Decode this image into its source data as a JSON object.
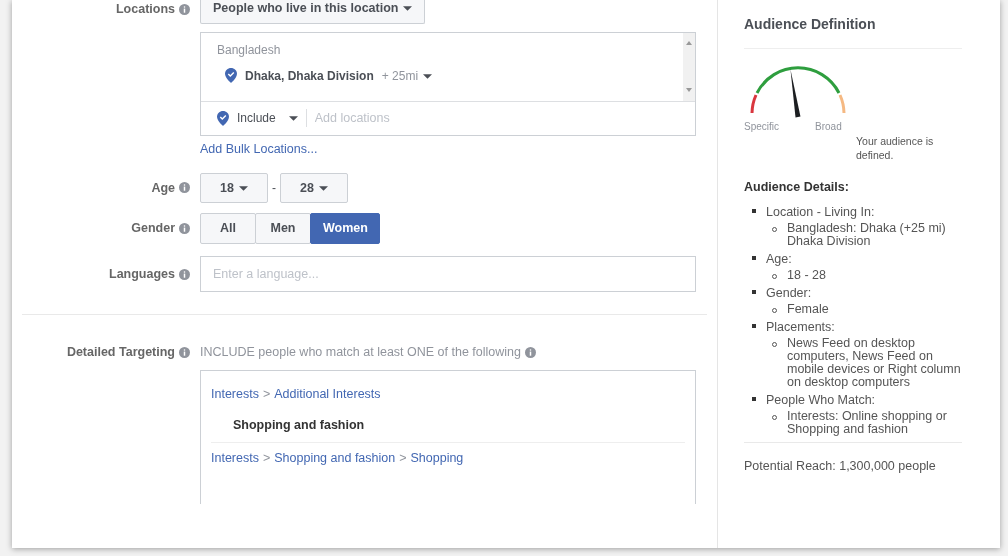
{
  "targeting": {
    "locations": {
      "label": "Locations",
      "type_dropdown": "People who live in this location",
      "groups": [
        {
          "country": "Bangladesh",
          "places": [
            {
              "name": "Dhaka, Dhaka Division",
              "radius": "+ 25mi"
            }
          ]
        }
      ],
      "include_dropdown": "Include",
      "placeholder": "Add locations",
      "bulk_link": "Add Bulk Locations..."
    },
    "age": {
      "label": "Age",
      "min": "18",
      "separator": "-",
      "max": "28"
    },
    "gender": {
      "label": "Gender",
      "options": [
        {
          "label": "All",
          "selected": false
        },
        {
          "label": "Men",
          "selected": false
        },
        {
          "label": "Women",
          "selected": true
        }
      ]
    },
    "languages": {
      "label": "Languages",
      "placeholder": "Enter a language..."
    },
    "detailed": {
      "label": "Detailed Targeting",
      "intro": "INCLUDE people who match at least ONE of the following",
      "separator": ">",
      "groups": [
        {
          "path": [
            "Interests",
            "Additional Interests"
          ],
          "items": [
            "Shopping and fashion"
          ]
        },
        {
          "path": [
            "Interests",
            "Shopping and fashion",
            "Shopping"
          ]
        }
      ]
    }
  },
  "audience": {
    "title": "Audience Definition",
    "gauge": {
      "level": 0.45,
      "low_label": "Specific",
      "high_label": "Broad",
      "message": "Your audience is defined."
    },
    "details_title": "Audience Details:",
    "details": [
      {
        "label": "Location - Living In:",
        "items": [
          "Bangladesh: Dhaka (+25 mi) Dhaka Division"
        ]
      },
      {
        "label": "Age:",
        "items": [
          "18 - 28"
        ]
      },
      {
        "label": "Gender:",
        "items": [
          "Female"
        ]
      },
      {
        "label": "Placements:",
        "items": [
          "News Feed on desktop computers, News Feed on mobile devices or Right column on desktop computers"
        ]
      },
      {
        "label": "People Who Match:",
        "items": [
          "Interests: Online shopping or Shopping and fashion"
        ]
      }
    ],
    "reach": "Potential Reach: 1,300,000 people"
  }
}
